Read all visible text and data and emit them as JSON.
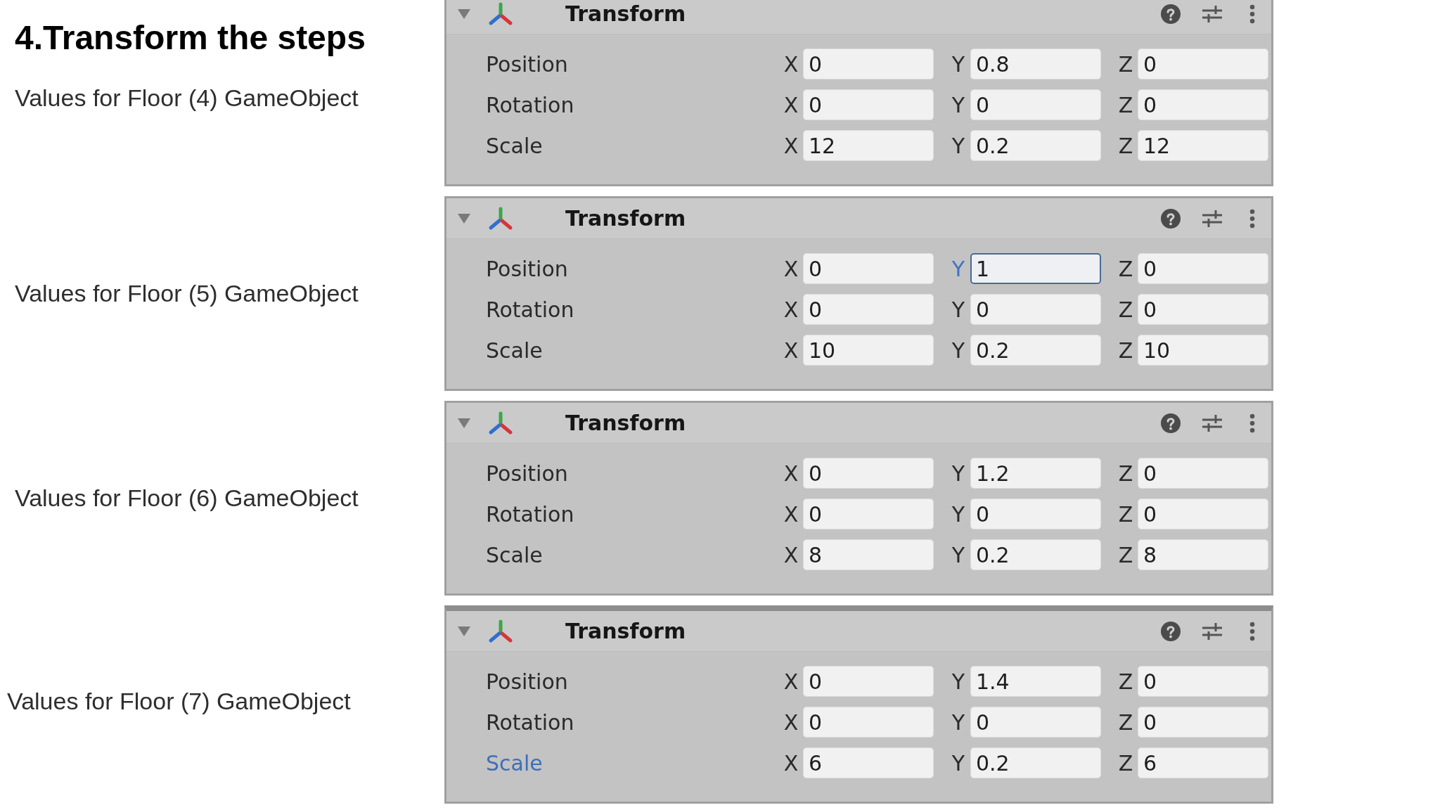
{
  "title": "4.Transform the steps",
  "steps": [
    {
      "caption": "Values for Floor (4) GameObject",
      "inspector": {
        "header": "Transform",
        "expanded": true,
        "rows": [
          {
            "label": "Position",
            "highlighted": false,
            "fields": [
              {
                "axis": "X",
                "value": "0",
                "focused": false
              },
              {
                "axis": "Y",
                "value": "0.8",
                "focused": false
              },
              {
                "axis": "Z",
                "value": "0",
                "focused": false
              }
            ]
          },
          {
            "label": "Rotation",
            "highlighted": false,
            "fields": [
              {
                "axis": "X",
                "value": "0",
                "focused": false
              },
              {
                "axis": "Y",
                "value": "0",
                "focused": false
              },
              {
                "axis": "Z",
                "value": "0",
                "focused": false
              }
            ]
          },
          {
            "label": "Scale",
            "highlighted": false,
            "fields": [
              {
                "axis": "X",
                "value": "12",
                "focused": false
              },
              {
                "axis": "Y",
                "value": "0.2",
                "focused": false
              },
              {
                "axis": "Z",
                "value": "12",
                "focused": false
              }
            ]
          }
        ]
      }
    },
    {
      "caption": "Values for Floor (5) GameObject",
      "inspector": {
        "header": "Transform",
        "expanded": true,
        "rows": [
          {
            "label": "Position",
            "highlighted": false,
            "fields": [
              {
                "axis": "X",
                "value": "0",
                "focused": false
              },
              {
                "axis": "Y",
                "value": "1",
                "focused": true
              },
              {
                "axis": "Z",
                "value": "0",
                "focused": false
              }
            ]
          },
          {
            "label": "Rotation",
            "highlighted": false,
            "fields": [
              {
                "axis": "X",
                "value": "0",
                "focused": false
              },
              {
                "axis": "Y",
                "value": "0",
                "focused": false
              },
              {
                "axis": "Z",
                "value": "0",
                "focused": false
              }
            ]
          },
          {
            "label": "Scale",
            "highlighted": false,
            "fields": [
              {
                "axis": "X",
                "value": "10",
                "focused": false
              },
              {
                "axis": "Y",
                "value": "0.2",
                "focused": false
              },
              {
                "axis": "Z",
                "value": "10",
                "focused": false
              }
            ]
          }
        ]
      }
    },
    {
      "caption": "Values for Floor (6) GameObject",
      "inspector": {
        "header": "Transform",
        "expanded": true,
        "rows": [
          {
            "label": "Position",
            "highlighted": false,
            "fields": [
              {
                "axis": "X",
                "value": "0",
                "focused": false
              },
              {
                "axis": "Y",
                "value": "1.2",
                "focused": false
              },
              {
                "axis": "Z",
                "value": "0",
                "focused": false
              }
            ]
          },
          {
            "label": "Rotation",
            "highlighted": false,
            "fields": [
              {
                "axis": "X",
                "value": "0",
                "focused": false
              },
              {
                "axis": "Y",
                "value": "0",
                "focused": false
              },
              {
                "axis": "Z",
                "value": "0",
                "focused": false
              }
            ]
          },
          {
            "label": "Scale",
            "highlighted": false,
            "fields": [
              {
                "axis": "X",
                "value": "8",
                "focused": false
              },
              {
                "axis": "Y",
                "value": "0.2",
                "focused": false
              },
              {
                "axis": "Z",
                "value": "8",
                "focused": false
              }
            ]
          }
        ]
      }
    },
    {
      "caption": "Values for Floor (7) GameObject",
      "inspector": {
        "header": "Transform",
        "expanded": true,
        "rows": [
          {
            "label": "Position",
            "highlighted": false,
            "fields": [
              {
                "axis": "X",
                "value": "0",
                "focused": false
              },
              {
                "axis": "Y",
                "value": "1.4",
                "focused": false
              },
              {
                "axis": "Z",
                "value": "0",
                "focused": false
              }
            ]
          },
          {
            "label": "Rotation",
            "highlighted": false,
            "fields": [
              {
                "axis": "X",
                "value": "0",
                "focused": false
              },
              {
                "axis": "Y",
                "value": "0",
                "focused": false
              },
              {
                "axis": "Z",
                "value": "0",
                "focused": false
              }
            ]
          },
          {
            "label": "Scale",
            "highlighted": true,
            "fields": [
              {
                "axis": "X",
                "value": "6",
                "focused": false
              },
              {
                "axis": "Y",
                "value": "0.2",
                "focused": false
              },
              {
                "axis": "Z",
                "value": "6",
                "focused": false
              }
            ]
          }
        ]
      }
    }
  ]
}
